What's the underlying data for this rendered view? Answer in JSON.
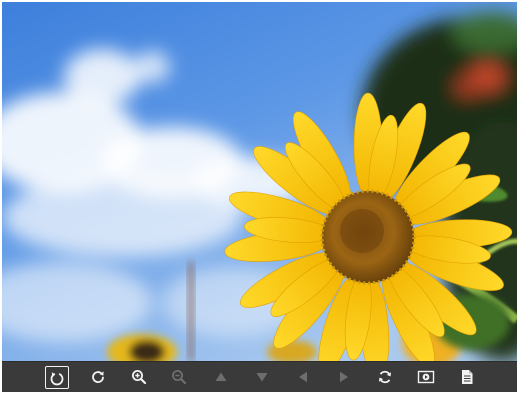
{
  "viewer": {
    "image_subject": "sunflower",
    "toolbar": {
      "tools": [
        {
          "id": "rotate-left",
          "icon": "rotate-left-icon",
          "active": true,
          "enabled": true
        },
        {
          "id": "rotate-right",
          "icon": "rotate-right-icon",
          "active": false,
          "enabled": true
        },
        {
          "id": "zoom-in",
          "icon": "zoom-in-icon",
          "active": false,
          "enabled": true
        },
        {
          "id": "zoom-out",
          "icon": "zoom-out-icon",
          "active": false,
          "enabled": false
        },
        {
          "id": "move-up",
          "icon": "triangle-up-icon",
          "active": false,
          "enabled": false
        },
        {
          "id": "move-down",
          "icon": "triangle-down-icon",
          "active": false,
          "enabled": false
        },
        {
          "id": "move-left",
          "icon": "triangle-left-icon",
          "active": false,
          "enabled": false
        },
        {
          "id": "move-right",
          "icon": "triangle-right-icon",
          "active": false,
          "enabled": false
        },
        {
          "id": "reset",
          "icon": "reset-icon",
          "active": false,
          "enabled": true
        },
        {
          "id": "slideshow",
          "icon": "slideshow-icon",
          "active": false,
          "enabled": true
        },
        {
          "id": "info",
          "icon": "document-icon",
          "active": false,
          "enabled": true
        }
      ],
      "colors": {
        "enabled": "#f2f2f2",
        "disabled": "#6e6e6e",
        "background": "#3a3a3a"
      }
    }
  }
}
